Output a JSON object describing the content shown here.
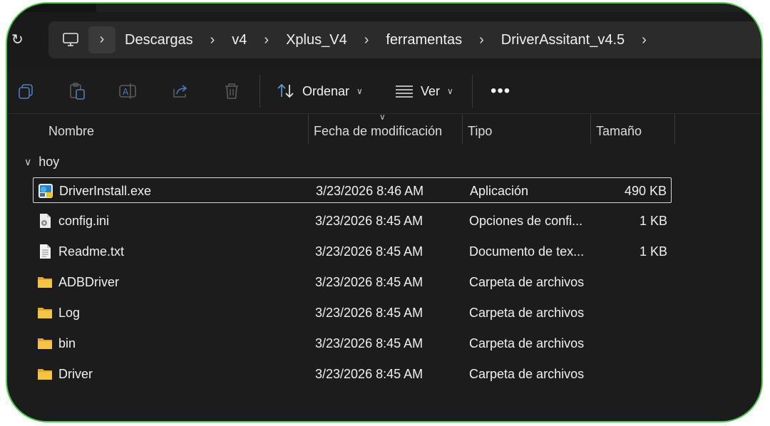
{
  "address_bar": {
    "crumbs": [
      "Descargas",
      "v4",
      "Xplus_V4",
      "ferramentas",
      "DriverAssitant_v4.5"
    ]
  },
  "toolbar": {
    "sort_label": "Ordenar",
    "view_label": "Ver",
    "more_label": "•••"
  },
  "columns": {
    "name": "Nombre",
    "date": "Fecha de modificación",
    "type": "Tipo",
    "size": "Tamaño"
  },
  "group": {
    "label": "hoy"
  },
  "files": [
    {
      "name": "DriverInstall.exe",
      "date": "3/23/2026 8:46 AM",
      "type": "Aplicación",
      "size": "490 KB",
      "icon": "exe-icon",
      "selected": true
    },
    {
      "name": "config.ini",
      "date": "3/23/2026 8:45 AM",
      "type": "Opciones de confi...",
      "size": "1 KB",
      "icon": "ini-file-icon",
      "selected": false
    },
    {
      "name": "Readme.txt",
      "date": "3/23/2026 8:45 AM",
      "type": "Documento de tex...",
      "size": "1 KB",
      "icon": "text-file-icon",
      "selected": false
    },
    {
      "name": "ADBDriver",
      "date": "3/23/2026 8:45 AM",
      "type": "Carpeta de archivos",
      "size": "",
      "icon": "folder-icon",
      "selected": false
    },
    {
      "name": "Log",
      "date": "3/23/2026 8:45 AM",
      "type": "Carpeta de archivos",
      "size": "",
      "icon": "folder-icon",
      "selected": false
    },
    {
      "name": "bin",
      "date": "3/23/2026 8:45 AM",
      "type": "Carpeta de archivos",
      "size": "",
      "icon": "folder-icon",
      "selected": false
    },
    {
      "name": "Driver",
      "date": "3/23/2026 8:45 AM",
      "type": "Carpeta de archivos",
      "size": "",
      "icon": "folder-icon",
      "selected": false
    }
  ],
  "colors": {
    "frame_border": "#4ecb4e",
    "window_bg": "#1c1c1c",
    "address_bg": "#2b2b2b",
    "folder": "#f5c542"
  }
}
